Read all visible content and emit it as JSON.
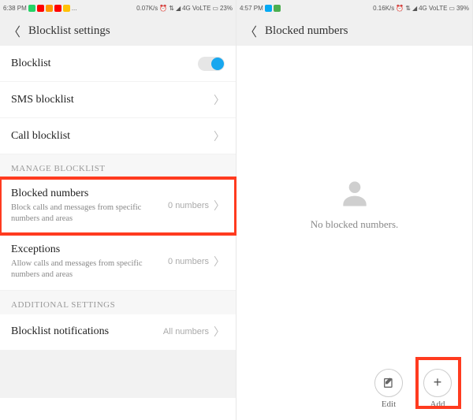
{
  "left": {
    "status": {
      "time": "6:38 PM",
      "net": "0.07K/s",
      "carrier": "4G VoLTE",
      "battery": "23%"
    },
    "title": "Blocklist settings",
    "rows": {
      "blocklist": "Blocklist",
      "sms": "SMS blocklist",
      "call": "Call blocklist"
    },
    "manage_header": "MANAGE BLOCKLIST",
    "blocked": {
      "title": "Blocked numbers",
      "sub": "Block calls and messages from specific numbers and areas",
      "trail": "0 numbers"
    },
    "exceptions": {
      "title": "Exceptions",
      "sub": "Allow calls and messages from specific numbers and areas",
      "trail": "0 numbers"
    },
    "additional_header": "ADDITIONAL SETTINGS",
    "notifications": {
      "title": "Blocklist notifications",
      "trail": "All numbers"
    }
  },
  "right": {
    "status": {
      "time": "4:57 PM",
      "net": "0.16K/s",
      "carrier": "4G VoLTE",
      "battery": "39%"
    },
    "title": "Blocked numbers",
    "empty": "No blocked numbers.",
    "edit": "Edit",
    "add": "Add"
  }
}
